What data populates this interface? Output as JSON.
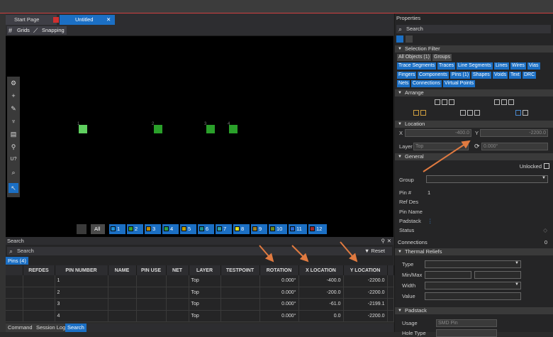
{
  "tabs": {
    "start": "Start Page",
    "untitled": "Untitled",
    "close": "✕"
  },
  "toolbar": {
    "grids": "Grids",
    "snapping": "Snapping"
  },
  "layers": [
    "All",
    "1",
    "2",
    "3",
    "4",
    "5",
    "6",
    "7",
    "8",
    "9",
    "10",
    "11",
    "12"
  ],
  "layer_colors": [
    "#1b6fc4",
    "#1e8fd8",
    "#3aa02a",
    "#c08a00",
    "#2aa04a",
    "#c0a000",
    "#1a9090",
    "#30a0a0",
    "#e0e020",
    "#a08020",
    "#6a8a20",
    "#2a6ad0",
    "#a02a2a"
  ],
  "pads": [
    "1",
    "2",
    "3",
    "4"
  ],
  "search": {
    "panel_title": "Search",
    "placeholder": "Search",
    "reset": "Reset",
    "pins_btn": "Pins (4)",
    "columns": [
      "REFDES",
      "PIN NUMBER",
      "NAME",
      "PIN USE",
      "NET",
      "LAYER",
      "TESTPOINT",
      "ROTATION",
      "X LOCATION",
      "Y LOCATION"
    ],
    "rows": [
      {
        "pin": "1",
        "layer": "Top",
        "rot": "0.000°",
        "x": "-400.0",
        "y": "-2200.0"
      },
      {
        "pin": "2",
        "layer": "Top",
        "rot": "0.000°",
        "x": "-200.0",
        "y": "-2200.0"
      },
      {
        "pin": "3",
        "layer": "Top",
        "rot": "0.000°",
        "x": "-61.0",
        "y": "-2199.1"
      },
      {
        "pin": "4",
        "layer": "Top",
        "rot": "0.000°",
        "x": "0.0",
        "y": "-2200.0"
      }
    ]
  },
  "bottom_tabs": [
    "Command",
    "Session Log",
    "Search"
  ],
  "props": {
    "title": "Properties",
    "search": "Search",
    "selection_filter": "Selection Filter",
    "chips_row1": [
      "All Objects (1)",
      "Groups"
    ],
    "chips_row2": [
      "Trace Segments",
      "Traces",
      "Line Segments",
      "Lines",
      "Wires",
      "Vias"
    ],
    "chips_row3": [
      "Fingers",
      "Components",
      "Pins (1)",
      "Shapes",
      "Voids",
      "Text",
      "DRC"
    ],
    "chips_row4": [
      "Nets",
      "Connections",
      "Virtual Points"
    ],
    "arrange": "Arrange",
    "location": "Location",
    "x_label": "X",
    "x_val": "-400.0",
    "y_label": "Y",
    "y_val": "-2200.0",
    "layer_label": "Layer",
    "layer_val": "Top",
    "angle_val": "0.000°",
    "general": "General",
    "unlocked": "Unlocked",
    "group": "Group",
    "pin_num_label": "Pin #",
    "pin_num": "1",
    "refdes": "Ref Des",
    "pin_name": "Pin Name",
    "padstack_label": "Padstack",
    "status": "Status",
    "connections": "Connections",
    "connections_val": "0",
    "thermal": "Thermal Reliefs",
    "type": "Type",
    "minmax": "Min/Max",
    "width": "Width",
    "value": "Value",
    "padstack_section": "Padstack",
    "usage": "Usage",
    "usage_val": "SMD Pin",
    "hole_type": "Hole Type"
  }
}
